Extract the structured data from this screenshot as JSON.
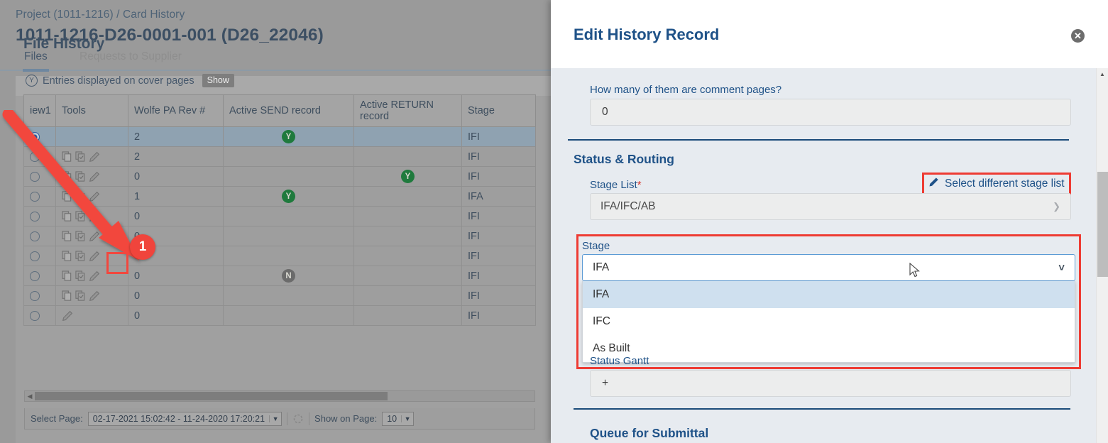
{
  "left": {
    "breadcrumb": "Project (1011-1216) / Card History",
    "page_title": "1011-1216-D26-0001-001 (D26_22046)",
    "tabs": [
      {
        "label": "Files",
        "active": true
      },
      {
        "label": "Requests to Supplier",
        "active": false
      }
    ],
    "card": {
      "title": "File History",
      "cover_pages_badge": "Y",
      "cover_pages_text": "Entries displayed on cover pages",
      "show_button": "Show"
    },
    "table": {
      "columns": [
        "iew1",
        "Tools",
        "Wolfe PA Rev #",
        "Active SEND record",
        "Active RETURN record",
        "Stage"
      ],
      "rows": [
        {
          "selected": true,
          "tools": [],
          "rev": "2",
          "send": "Y",
          "return": "",
          "stage": "IFI"
        },
        {
          "selected": false,
          "tools": [
            "copy",
            "copy2",
            "pencil"
          ],
          "rev": "2",
          "send": "",
          "return": "",
          "stage": "IFI"
        },
        {
          "selected": false,
          "tools": [
            "copy",
            "copy2",
            "pencil"
          ],
          "rev": "0",
          "send": "",
          "return": "Y",
          "stage": "IFI"
        },
        {
          "selected": false,
          "tools": [
            "copy",
            "copy2",
            "pencil"
          ],
          "rev": "1",
          "send": "Y",
          "return": "",
          "stage": "IFA"
        },
        {
          "selected": false,
          "tools": [
            "copy",
            "copy2",
            "pencil"
          ],
          "rev": "0",
          "send": "",
          "return": "",
          "stage": "IFI"
        },
        {
          "selected": false,
          "tools": [
            "copy",
            "copy2",
            "pencil"
          ],
          "rev": "0",
          "send": "",
          "return": "",
          "stage": "IFI"
        },
        {
          "selected": false,
          "tools": [
            "copy",
            "copy2",
            "pencil"
          ],
          "rev": "0",
          "send": "",
          "return": "",
          "stage": "IFI"
        },
        {
          "selected": false,
          "tools": [
            "copy",
            "copy2",
            "pencil"
          ],
          "rev": "0",
          "send": "N",
          "return": "",
          "stage": "IFI"
        },
        {
          "selected": false,
          "tools": [
            "copy",
            "copy2",
            "pencil"
          ],
          "rev": "0",
          "send": "",
          "return": "",
          "stage": "IFI"
        },
        {
          "selected": false,
          "tools": [
            "pencil"
          ],
          "rev": "0",
          "send": "",
          "return": "",
          "stage": "IFI"
        }
      ]
    },
    "pager": {
      "select_page_label": "Select Page:",
      "select_page_value": "02-17-2021 15:02:42 - 11-24-2020 17:20:21",
      "show_on_page_label": "Show on Page:",
      "show_on_page_value": "10"
    },
    "annotation": {
      "step_number": "1"
    }
  },
  "modal": {
    "title": "Edit History Record",
    "close_label": "✕",
    "comment_pages": {
      "label": "How many of them are comment pages?",
      "value": "0"
    },
    "status_routing": {
      "section_title": "Status & Routing",
      "stage_list_label": "Stage List",
      "stage_list_required": "*",
      "select_different_link": "Select different stage list",
      "stage_list_value": "IFA/IFC/AB",
      "stage_label": "Stage",
      "stage_value": "IFA",
      "stage_options": [
        {
          "label": "IFA",
          "selected": true
        },
        {
          "label": "IFC",
          "selected": false
        },
        {
          "label": "As Built",
          "selected": false
        }
      ],
      "status_gantt_label": "Status Gantt",
      "status_gantt_value": "+"
    },
    "queue_title": "Queue for Submittal"
  },
  "colors": {
    "accent_blue": "#1f5288",
    "highlight_red": "#ee3b33",
    "badge_green": "#1f7a3d",
    "badge_gray": "#6b6b6b",
    "modal_bg": "#e7ebf0",
    "page_bg": "#999999"
  }
}
